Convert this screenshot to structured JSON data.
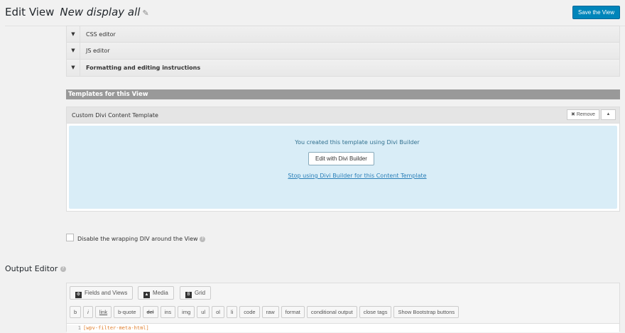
{
  "header": {
    "title": "Edit View",
    "view_name": "New display all",
    "save_label": "Save the View"
  },
  "accordions": [
    {
      "label": "CSS editor"
    },
    {
      "label": "JS editor"
    },
    {
      "label": "Formatting and editing instructions"
    }
  ],
  "templates": {
    "section_title": "Templates for this View",
    "template_name": "Custom Divi Content Template",
    "remove_label": "Remove",
    "message": "You created this template using Divi Builder",
    "edit_label": "Edit with Divi Builder",
    "stop_label": "Stop using Divi Builder for this Content Template"
  },
  "wrapping": {
    "label": "Disable the wrapping DIV around the View",
    "checked": false
  },
  "output_editor": {
    "title": "Output Editor",
    "toolbar": [
      "Fields and Views",
      "Media",
      "Grid"
    ],
    "quicktags": [
      "b",
      "i",
      "link",
      "b-quote",
      "del",
      "ins",
      "img",
      "ul",
      "ol",
      "li",
      "code",
      "raw",
      "format",
      "conditional output",
      "close tags",
      "Show Bootstrap buttons"
    ],
    "line_number": "1",
    "code_line": "[wpv-filter-meta-html]"
  }
}
